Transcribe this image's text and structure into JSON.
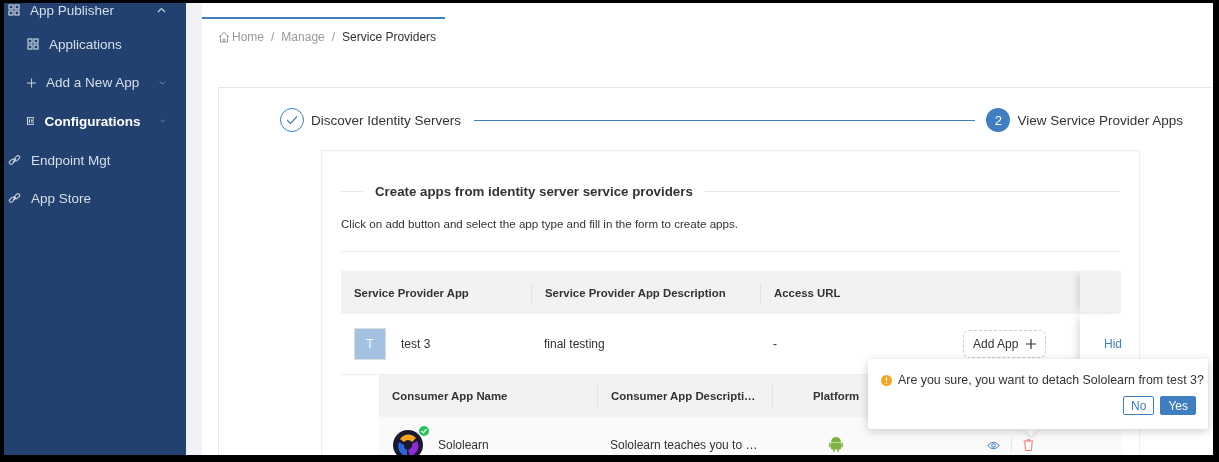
{
  "sidebar": {
    "items": [
      {
        "label": "App Publisher",
        "expanded": true,
        "selected": false,
        "children": [
          {
            "label": "Applications",
            "selected": false
          },
          {
            "label": "Add a New App",
            "expanded": false,
            "selected": false
          },
          {
            "label": "Configurations",
            "expanded": false,
            "selected": true
          }
        ]
      },
      {
        "label": "Endpoint Mgt",
        "selected": false
      },
      {
        "label": "App Store",
        "selected": false
      }
    ]
  },
  "breadcrumb": [
    {
      "label": "Home",
      "current": false
    },
    {
      "separator": "/",
      "label": "Manage",
      "current": false
    },
    {
      "separator": "/",
      "label": "Service Providers",
      "current": true
    }
  ],
  "steps": [
    {
      "label": "Discover Identity Servers",
      "kind": "done"
    },
    {
      "label": "View Service Provider Apps",
      "number": "2",
      "kind": "active"
    }
  ],
  "section": {
    "title": "Create apps from identity server service providers",
    "description": "Click on add button and select the app type and fill in the form to create apps."
  },
  "table": {
    "columns": [
      "Service Provider App",
      "Service Provider App Description",
      "Access URL"
    ],
    "rows": [
      {
        "avatar": "T",
        "name": "test 3",
        "description": "final testing",
        "access_url": "-",
        "add_button": "Add App",
        "toggle_link": "Hid"
      }
    ]
  },
  "consumer_table": {
    "columns": [
      "Consumer App Name",
      "Consumer App Descripti…",
      "Platform"
    ],
    "rows": [
      {
        "name": "Sololearn",
        "description": "Sololearn teaches you to …",
        "verified": true
      }
    ]
  },
  "popconfirm": {
    "message": "Are you sure, you want to detach Sololearn from test 3?",
    "buttons": [
      {
        "label": "No",
        "kind": "secondary"
      },
      {
        "label": "Yes",
        "kind": "primary"
      }
    ]
  }
}
